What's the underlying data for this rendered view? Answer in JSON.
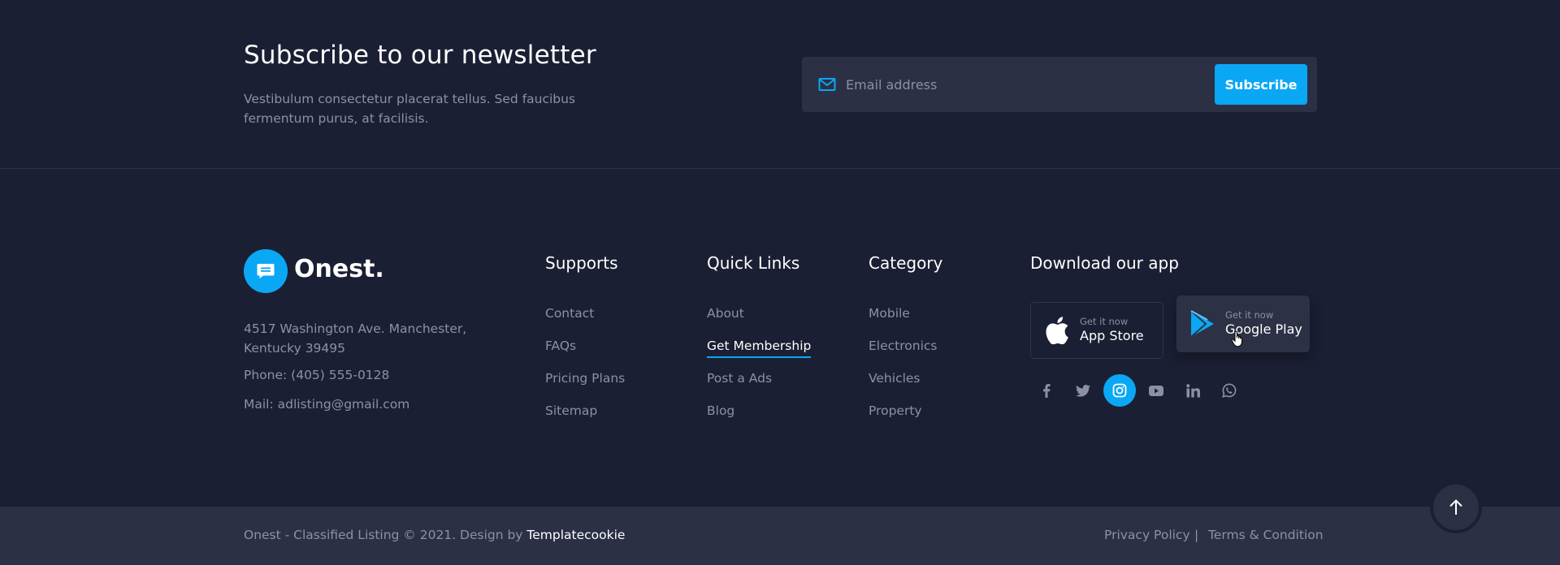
{
  "newsletter": {
    "title": "Subscribe to our newsletter",
    "description": "Vestibulum consectetur placerat tellus. Sed faucibus fermentum purus, at facilisis.",
    "email_placeholder": "Email address",
    "button_label": "Subscribe"
  },
  "brand": {
    "name": "Onest.",
    "address": "4517 Washington Ave. Manchester, Kentucky 39495",
    "phone": "Phone: (405) 555-0128",
    "mail": "Mail: adlisting@gmail.com"
  },
  "columns": [
    {
      "title": "Supports",
      "links": [
        "Contact",
        "FAQs",
        "Pricing Plans",
        "Sitemap"
      ]
    },
    {
      "title": "Quick Links",
      "links": [
        "About",
        "Get Membership",
        "Post a Ads",
        "Blog"
      ],
      "active_index": 1
    },
    {
      "title": "Category",
      "links": [
        "Mobile",
        "Electronics",
        "Vehicles",
        "Property"
      ]
    }
  ],
  "download": {
    "title": "Download our app",
    "app_store": {
      "small": "Get it now",
      "big": "App Store",
      "icon": "apple-icon"
    },
    "google_play": {
      "small": "Get it now",
      "big": "Google Play",
      "icon": "google-play-icon"
    }
  },
  "social": [
    {
      "name": "facebook-icon"
    },
    {
      "name": "twitter-icon"
    },
    {
      "name": "instagram-icon",
      "active": true
    },
    {
      "name": "youtube-icon"
    },
    {
      "name": "linkedin-icon"
    },
    {
      "name": "whatsapp-icon"
    }
  ],
  "footer": {
    "copyright": "Onest - Classified Listing © 2021. Design by",
    "designer": "Templatecookie",
    "privacy": "Privacy Policy",
    "separator": "|",
    "terms": "Terms & Condition"
  },
  "colors": {
    "background": "#1b1f33",
    "panel": "#2b3045",
    "accent": "#0aa7f5",
    "text_muted": "#8d91a4",
    "text_primary": "#ffffff"
  }
}
